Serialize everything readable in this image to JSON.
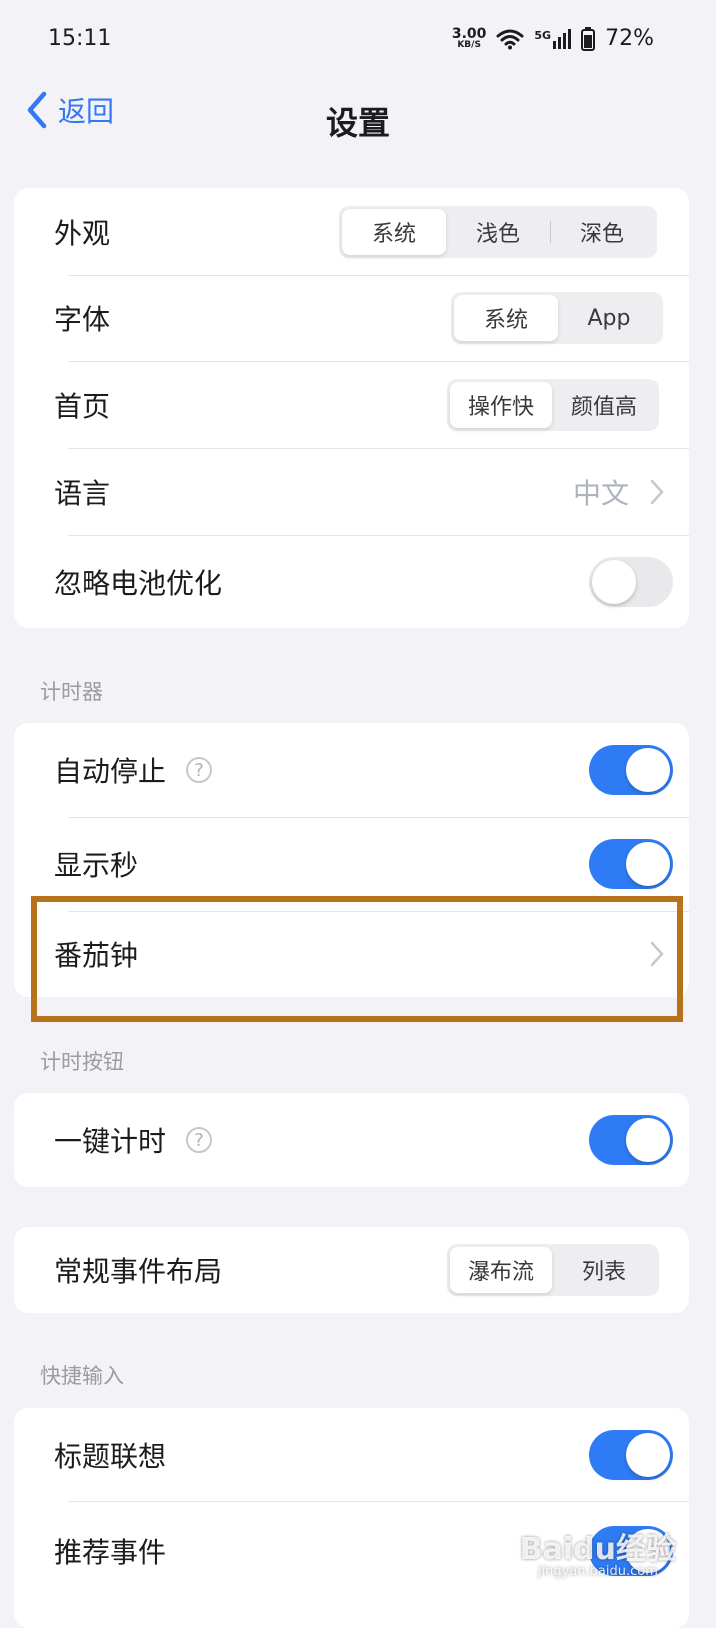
{
  "status_bar": {
    "time": "15:11",
    "net_speed_value": "3.00",
    "net_speed_unit": "KB/S",
    "signal_label": "5G",
    "battery": "72%"
  },
  "nav": {
    "back_label": "返回",
    "title": "设置"
  },
  "general": {
    "appearance": {
      "label": "外观",
      "options": [
        "系统",
        "浅色",
        "深色"
      ],
      "selected": "系统"
    },
    "font": {
      "label": "字体",
      "options": [
        "系统",
        "App"
      ],
      "selected": "系统"
    },
    "home": {
      "label": "首页",
      "options": [
        "操作快",
        "颜值高"
      ],
      "selected": "操作快"
    },
    "language": {
      "label": "语言",
      "value": "中文"
    },
    "ignore_battery": {
      "label": "忽略电池优化",
      "on": false
    }
  },
  "timer": {
    "header": "计时器",
    "auto_stop": {
      "label": "自动停止",
      "on": true
    },
    "show_seconds": {
      "label": "显示秒",
      "on": true
    },
    "pomodoro": {
      "label": "番茄钟"
    }
  },
  "timer_button": {
    "header": "计时按钮",
    "one_tap": {
      "label": "一键计时",
      "on": true
    }
  },
  "layout": {
    "label": "常规事件布局",
    "options": [
      "瀑布流",
      "列表"
    ],
    "selected": "瀑布流"
  },
  "quick_input": {
    "header": "快捷输入",
    "title_suggest": {
      "label": "标题联想",
      "on": true
    },
    "recommend": {
      "label": "推荐事件",
      "on": true
    }
  },
  "colors": {
    "accent": "#2f7bf5",
    "background": "#f2f2f7",
    "highlight": "#b8731a"
  },
  "watermark": {
    "text": "Baidu经验",
    "sub": "jingyan.baidu.com"
  }
}
